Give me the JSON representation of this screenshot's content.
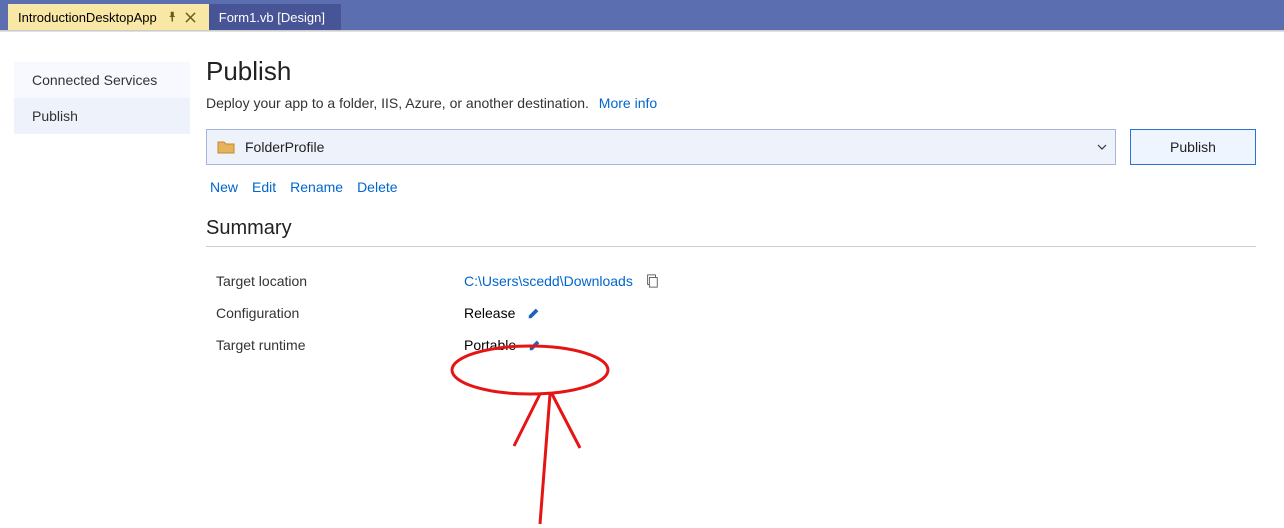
{
  "tabs": {
    "active": {
      "label": "IntroductionDesktopApp"
    },
    "inactive": {
      "label": "Form1.vb [Design]"
    }
  },
  "sidebar": {
    "items": [
      {
        "label": "Connected Services",
        "selected": false
      },
      {
        "label": "Publish",
        "selected": true
      }
    ]
  },
  "publish": {
    "title": "Publish",
    "subtitle": "Deploy your app to a folder, IIS, Azure, or another destination.",
    "more_info": "More info",
    "profile_name": "FolderProfile",
    "publish_button": "Publish",
    "actions": {
      "new": "New",
      "edit": "Edit",
      "rename": "Rename",
      "delete": "Delete"
    },
    "summary_title": "Summary",
    "rows": {
      "target_location": {
        "label": "Target location",
        "value": "C:\\Users\\scedd\\Downloads"
      },
      "configuration": {
        "label": "Configuration",
        "value": "Release"
      },
      "target_runtime": {
        "label": "Target runtime",
        "value": "Portable"
      }
    }
  },
  "colors": {
    "link": "#0066cc",
    "tabstrip": "#5b6eaf",
    "active_tab": "#f8e7a5",
    "panel_bg": "#eef2fb"
  }
}
